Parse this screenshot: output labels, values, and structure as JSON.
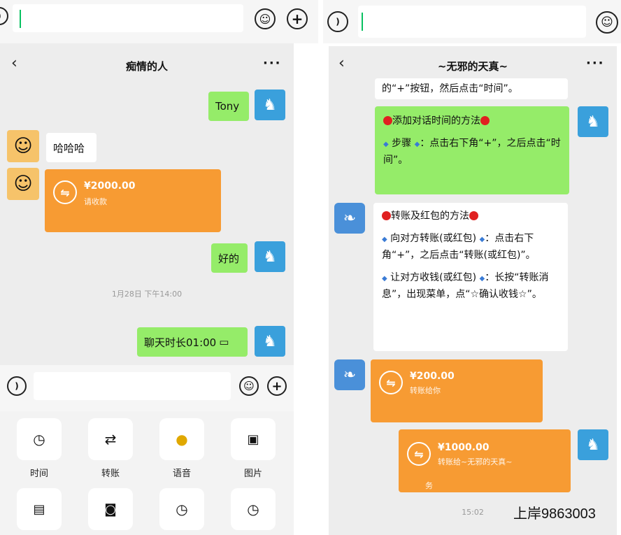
{
  "left": {
    "header_title": "痴情的人",
    "messages": {
      "tony": "Tony",
      "hahaha": "哈哈哈",
      "transfer_amount": "¥2000.00",
      "transfer_sub": "请收款",
      "ok": "好的",
      "timestamp": "1月28日 下午14:00",
      "call_duration": "聊天时长01:00"
    },
    "panel": [
      {
        "label": "时间",
        "icon": "clock-icon"
      },
      {
        "label": "转账",
        "icon": "transfer-icon"
      },
      {
        "label": "语音",
        "icon": "microphone-icon"
      },
      {
        "label": "图片",
        "icon": "image-icon"
      }
    ]
  },
  "right": {
    "header_title": "~无邪的天真~",
    "messages": {
      "cut_text": "的“+”按钮，然后点击“时间”。",
      "green_title": "添加对话时间的方法",
      "green_step_label": "步骤",
      "green_step_text": "：点击右下角“+”，之后点击“时间”。",
      "white_title": "转账及红包的方法",
      "white_item1_label": "向对方转账(或红包)",
      "white_item1_text": "：点击右下角“+”，之后点击“转账(或红包)”。",
      "white_item2_label": "让对方收钱(或红包)",
      "white_item2_text": "：长按“转账消息”，出现菜单，点“☆确认收钱☆”。",
      "transfer1_amount": "¥200.00",
      "transfer1_sub": "转账给你",
      "transfer2_amount": "¥1000.00",
      "transfer2_sub": "转账给~无邪的天真~",
      "transfer2_footer": "务",
      "timestamp": "15:02"
    }
  },
  "watermark": "上岸9863003",
  "colors": {
    "green_bubble": "#95ec69",
    "transfer_orange": "#f79b33",
    "chat_bg": "#ededed"
  }
}
